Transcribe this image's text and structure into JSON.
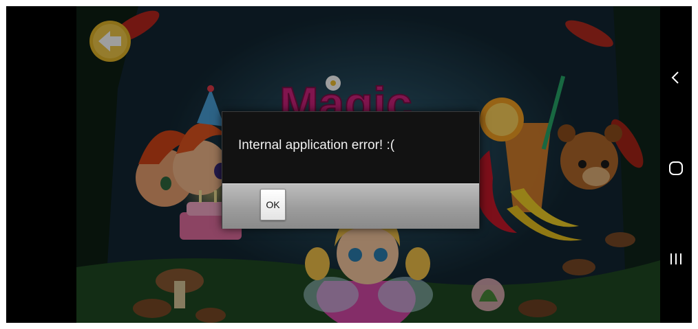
{
  "game": {
    "title": "Magic"
  },
  "dialog": {
    "message": "Internal application error! :(",
    "ok_label": "OK"
  },
  "navbar": {
    "back_icon": "chevron-left-icon",
    "home_icon": "rounded-square-home-icon",
    "recents_icon": "three-bars-recents-icon"
  },
  "colors": {
    "title_magenta": "#d0227f",
    "back_button_yellow": "#e2b529",
    "dialog_bg": "#121212",
    "dialog_bar_gray": "#a8a8a8"
  }
}
